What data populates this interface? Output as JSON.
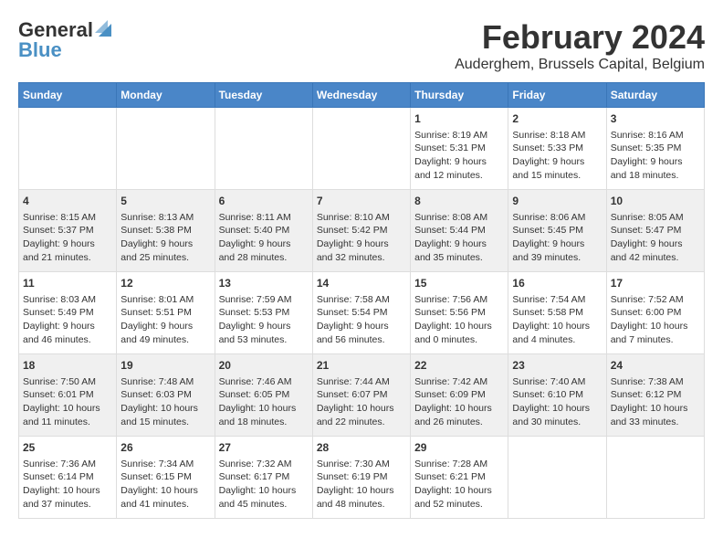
{
  "title": "February 2024",
  "subtitle": "Auderghem, Brussels Capital, Belgium",
  "logo": {
    "line1": "General",
    "line2": "Blue"
  },
  "days_header": [
    "Sunday",
    "Monday",
    "Tuesday",
    "Wednesday",
    "Thursday",
    "Friday",
    "Saturday"
  ],
  "weeks": [
    [
      {
        "day": "",
        "content": ""
      },
      {
        "day": "",
        "content": ""
      },
      {
        "day": "",
        "content": ""
      },
      {
        "day": "",
        "content": ""
      },
      {
        "day": "1",
        "content": "Sunrise: 8:19 AM\nSunset: 5:31 PM\nDaylight: 9 hours\nand 12 minutes."
      },
      {
        "day": "2",
        "content": "Sunrise: 8:18 AM\nSunset: 5:33 PM\nDaylight: 9 hours\nand 15 minutes."
      },
      {
        "day": "3",
        "content": "Sunrise: 8:16 AM\nSunset: 5:35 PM\nDaylight: 9 hours\nand 18 minutes."
      }
    ],
    [
      {
        "day": "4",
        "content": "Sunrise: 8:15 AM\nSunset: 5:37 PM\nDaylight: 9 hours\nand 21 minutes."
      },
      {
        "day": "5",
        "content": "Sunrise: 8:13 AM\nSunset: 5:38 PM\nDaylight: 9 hours\nand 25 minutes."
      },
      {
        "day": "6",
        "content": "Sunrise: 8:11 AM\nSunset: 5:40 PM\nDaylight: 9 hours\nand 28 minutes."
      },
      {
        "day": "7",
        "content": "Sunrise: 8:10 AM\nSunset: 5:42 PM\nDaylight: 9 hours\nand 32 minutes."
      },
      {
        "day": "8",
        "content": "Sunrise: 8:08 AM\nSunset: 5:44 PM\nDaylight: 9 hours\nand 35 minutes."
      },
      {
        "day": "9",
        "content": "Sunrise: 8:06 AM\nSunset: 5:45 PM\nDaylight: 9 hours\nand 39 minutes."
      },
      {
        "day": "10",
        "content": "Sunrise: 8:05 AM\nSunset: 5:47 PM\nDaylight: 9 hours\nand 42 minutes."
      }
    ],
    [
      {
        "day": "11",
        "content": "Sunrise: 8:03 AM\nSunset: 5:49 PM\nDaylight: 9 hours\nand 46 minutes."
      },
      {
        "day": "12",
        "content": "Sunrise: 8:01 AM\nSunset: 5:51 PM\nDaylight: 9 hours\nand 49 minutes."
      },
      {
        "day": "13",
        "content": "Sunrise: 7:59 AM\nSunset: 5:53 PM\nDaylight: 9 hours\nand 53 minutes."
      },
      {
        "day": "14",
        "content": "Sunrise: 7:58 AM\nSunset: 5:54 PM\nDaylight: 9 hours\nand 56 minutes."
      },
      {
        "day": "15",
        "content": "Sunrise: 7:56 AM\nSunset: 5:56 PM\nDaylight: 10 hours\nand 0 minutes."
      },
      {
        "day": "16",
        "content": "Sunrise: 7:54 AM\nSunset: 5:58 PM\nDaylight: 10 hours\nand 4 minutes."
      },
      {
        "day": "17",
        "content": "Sunrise: 7:52 AM\nSunset: 6:00 PM\nDaylight: 10 hours\nand 7 minutes."
      }
    ],
    [
      {
        "day": "18",
        "content": "Sunrise: 7:50 AM\nSunset: 6:01 PM\nDaylight: 10 hours\nand 11 minutes."
      },
      {
        "day": "19",
        "content": "Sunrise: 7:48 AM\nSunset: 6:03 PM\nDaylight: 10 hours\nand 15 minutes."
      },
      {
        "day": "20",
        "content": "Sunrise: 7:46 AM\nSunset: 6:05 PM\nDaylight: 10 hours\nand 18 minutes."
      },
      {
        "day": "21",
        "content": "Sunrise: 7:44 AM\nSunset: 6:07 PM\nDaylight: 10 hours\nand 22 minutes."
      },
      {
        "day": "22",
        "content": "Sunrise: 7:42 AM\nSunset: 6:09 PM\nDaylight: 10 hours\nand 26 minutes."
      },
      {
        "day": "23",
        "content": "Sunrise: 7:40 AM\nSunset: 6:10 PM\nDaylight: 10 hours\nand 30 minutes."
      },
      {
        "day": "24",
        "content": "Sunrise: 7:38 AM\nSunset: 6:12 PM\nDaylight: 10 hours\nand 33 minutes."
      }
    ],
    [
      {
        "day": "25",
        "content": "Sunrise: 7:36 AM\nSunset: 6:14 PM\nDaylight: 10 hours\nand 37 minutes."
      },
      {
        "day": "26",
        "content": "Sunrise: 7:34 AM\nSunset: 6:15 PM\nDaylight: 10 hours\nand 41 minutes."
      },
      {
        "day": "27",
        "content": "Sunrise: 7:32 AM\nSunset: 6:17 PM\nDaylight: 10 hours\nand 45 minutes."
      },
      {
        "day": "28",
        "content": "Sunrise: 7:30 AM\nSunset: 6:19 PM\nDaylight: 10 hours\nand 48 minutes."
      },
      {
        "day": "29",
        "content": "Sunrise: 7:28 AM\nSunset: 6:21 PM\nDaylight: 10 hours\nand 52 minutes."
      },
      {
        "day": "",
        "content": ""
      },
      {
        "day": "",
        "content": ""
      }
    ]
  ]
}
